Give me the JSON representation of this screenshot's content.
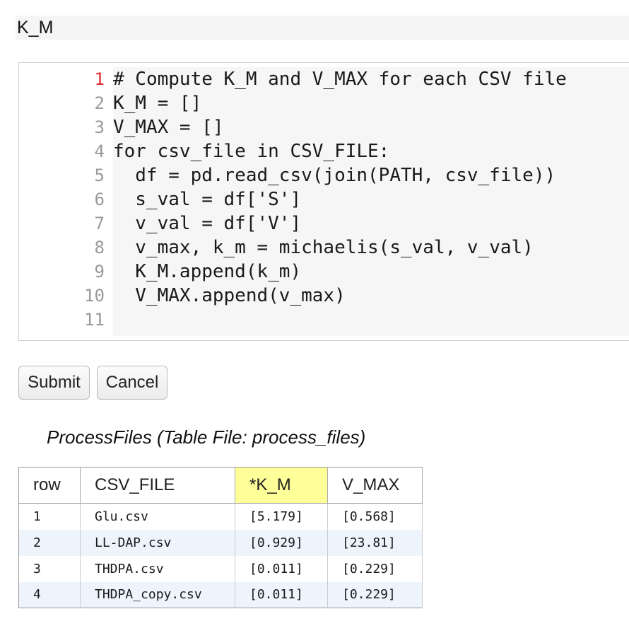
{
  "cell_name": "K_M",
  "editor": {
    "active_line": 1,
    "line_numbers": [
      "1",
      "2",
      "3",
      "4",
      "5",
      "6",
      "7",
      "8",
      "9",
      "10",
      "11"
    ],
    "lines": [
      "# Compute K_M and V_MAX for each CSV file",
      "K_M = []",
      "V_MAX = []",
      "for csv_file in CSV_FILE:",
      "  df = pd.read_csv(join(PATH, csv_file))",
      "  s_val = df['S']",
      "  v_val = df['V']",
      "  v_max, k_m = michaelis(s_val, v_val)",
      "  K_M.append(k_m)",
      "  V_MAX.append(v_max)",
      ""
    ]
  },
  "buttons": {
    "submit_label": "Submit",
    "cancel_label": "Cancel"
  },
  "table": {
    "caption": "ProcessFiles (Table File: process_files)",
    "headers": [
      "row",
      "CSV_FILE",
      "*K_M",
      "V_MAX"
    ],
    "highlight_header": "*K_M",
    "rows": [
      [
        "1",
        "Glu.csv",
        "[5.179]",
        "[0.568]"
      ],
      [
        "2",
        "LL-DAP.csv",
        "[0.929]",
        "[23.81]"
      ],
      [
        "3",
        "THDPA.csv",
        "[0.011]",
        "[0.229]"
      ],
      [
        "4",
        "THDPA_copy.csv",
        "[0.011]",
        "[0.229]"
      ]
    ]
  },
  "colors": {
    "active_line_number": "#e0262c",
    "highlight_header": "#ffff99",
    "alt_row": "#eef4fc",
    "code_background": "#f6f6f6"
  }
}
